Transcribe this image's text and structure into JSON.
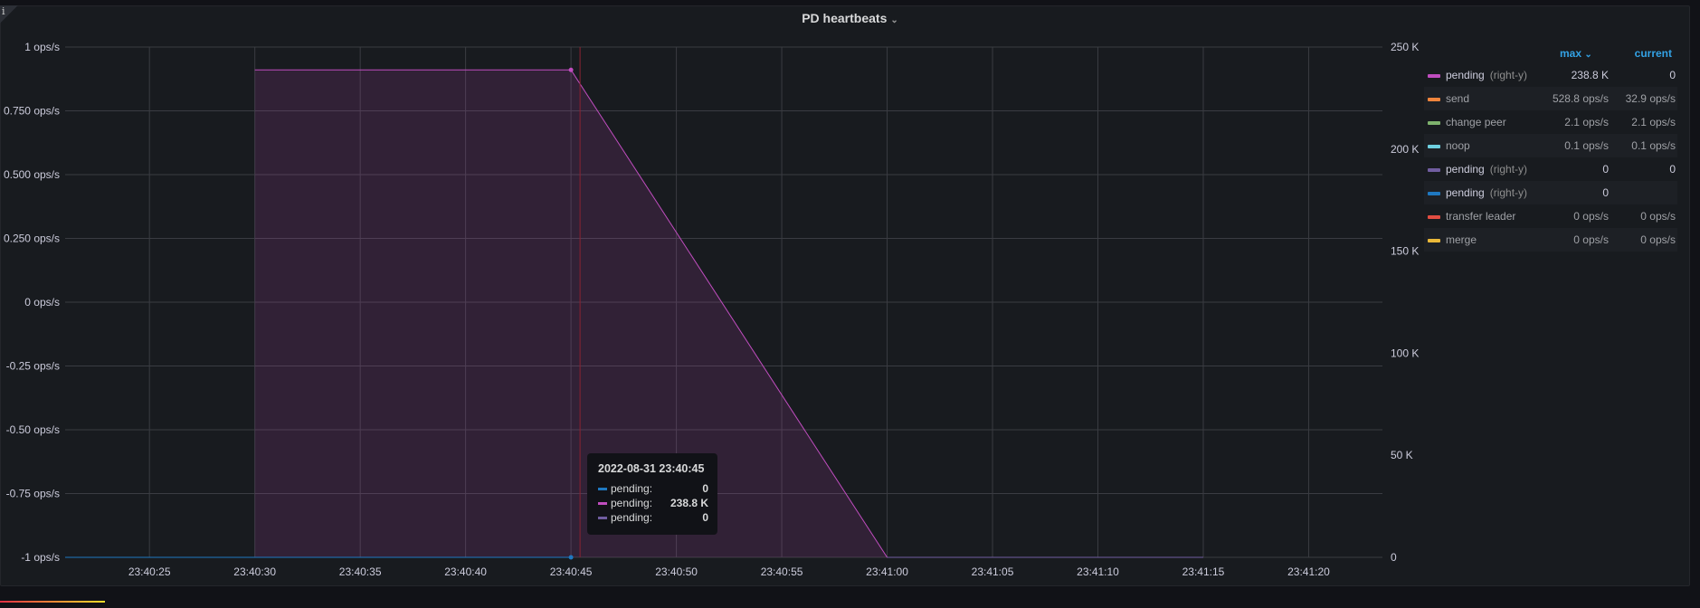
{
  "panel": {
    "title": "PD heartbeats",
    "info_icon": "i"
  },
  "chart_data": {
    "type": "line",
    "title": "PD heartbeats",
    "x_range": [
      "23:40:21",
      "23:41:23.5"
    ],
    "x_ticks": [
      "23:40:25",
      "23:40:30",
      "23:40:35",
      "23:40:40",
      "23:40:45",
      "23:40:50",
      "23:40:55",
      "23:41:00",
      "23:41:05",
      "23:41:10",
      "23:41:15",
      "23:41:20"
    ],
    "y_left": {
      "range": [
        -1,
        1
      ],
      "ticks": [
        "1 ops/s",
        "0.750 ops/s",
        "0.500 ops/s",
        "0.250 ops/s",
        "0 ops/s",
        "-0.25 ops/s",
        "-0.50 ops/s",
        "-0.75 ops/s",
        "-1 ops/s"
      ]
    },
    "y_right": {
      "range": [
        0,
        250000
      ],
      "ticks": [
        "250 K",
        "200 K",
        "150 K",
        "100 K",
        "50 K",
        "0"
      ]
    },
    "series": [
      {
        "name": "pending",
        "axis": "right",
        "color": "#c04dbf",
        "fill": true,
        "points": [
          [
            "23:40:30",
            238800
          ],
          [
            "23:40:45",
            238800
          ],
          [
            "23:41:00",
            0
          ],
          [
            "23:41:15",
            0
          ]
        ]
      },
      {
        "name": "pending",
        "axis": "right",
        "color": "#1f78c1",
        "fill": false,
        "points": [
          [
            "23:40:21",
            0
          ],
          [
            "23:40:45",
            0
          ]
        ]
      },
      {
        "name": "pending",
        "axis": "right",
        "color": "#705da0",
        "fill": false,
        "points": [
          [
            "23:41:00",
            0
          ],
          [
            "23:41:15",
            0
          ]
        ]
      }
    ],
    "grid": true
  },
  "legend": {
    "headers": {
      "max": "max",
      "max_sort_icon": "⌄",
      "current": "current"
    },
    "items": [
      {
        "name": "pending",
        "tag": "(right-y)",
        "color": "#c04dbf",
        "max": "238.8 K",
        "current": "0"
      },
      {
        "name": "send",
        "tag": "",
        "color": "#ef843c",
        "max": "528.8 ops/s",
        "current": "32.9 ops/s"
      },
      {
        "name": "change peer",
        "tag": "",
        "color": "#7eb26d",
        "max": "2.1 ops/s",
        "current": "2.1 ops/s"
      },
      {
        "name": "noop",
        "tag": "",
        "color": "#6ed0e0",
        "max": "0.1 ops/s",
        "current": "0.1 ops/s"
      },
      {
        "name": "pending",
        "tag": "(right-y)",
        "color": "#705da0",
        "max": "0",
        "current": "0"
      },
      {
        "name": "pending",
        "tag": "(right-y)",
        "color": "#1f78c1",
        "max": "0",
        "current": ""
      },
      {
        "name": "transfer leader",
        "tag": "",
        "color": "#e24d42",
        "max": "0 ops/s",
        "current": "0 ops/s"
      },
      {
        "name": "merge",
        "tag": "",
        "color": "#eab839",
        "max": "0 ops/s",
        "current": "0 ops/s"
      }
    ]
  },
  "tooltip": {
    "time": "2022-08-31 23:40:45",
    "rows": [
      {
        "label": "pending:",
        "value": "0",
        "color": "#1f78c1"
      },
      {
        "label": "pending:",
        "value": "238.8 K",
        "color": "#c04dbf"
      },
      {
        "label": "pending:",
        "value": "0",
        "color": "#705da0"
      }
    ]
  }
}
